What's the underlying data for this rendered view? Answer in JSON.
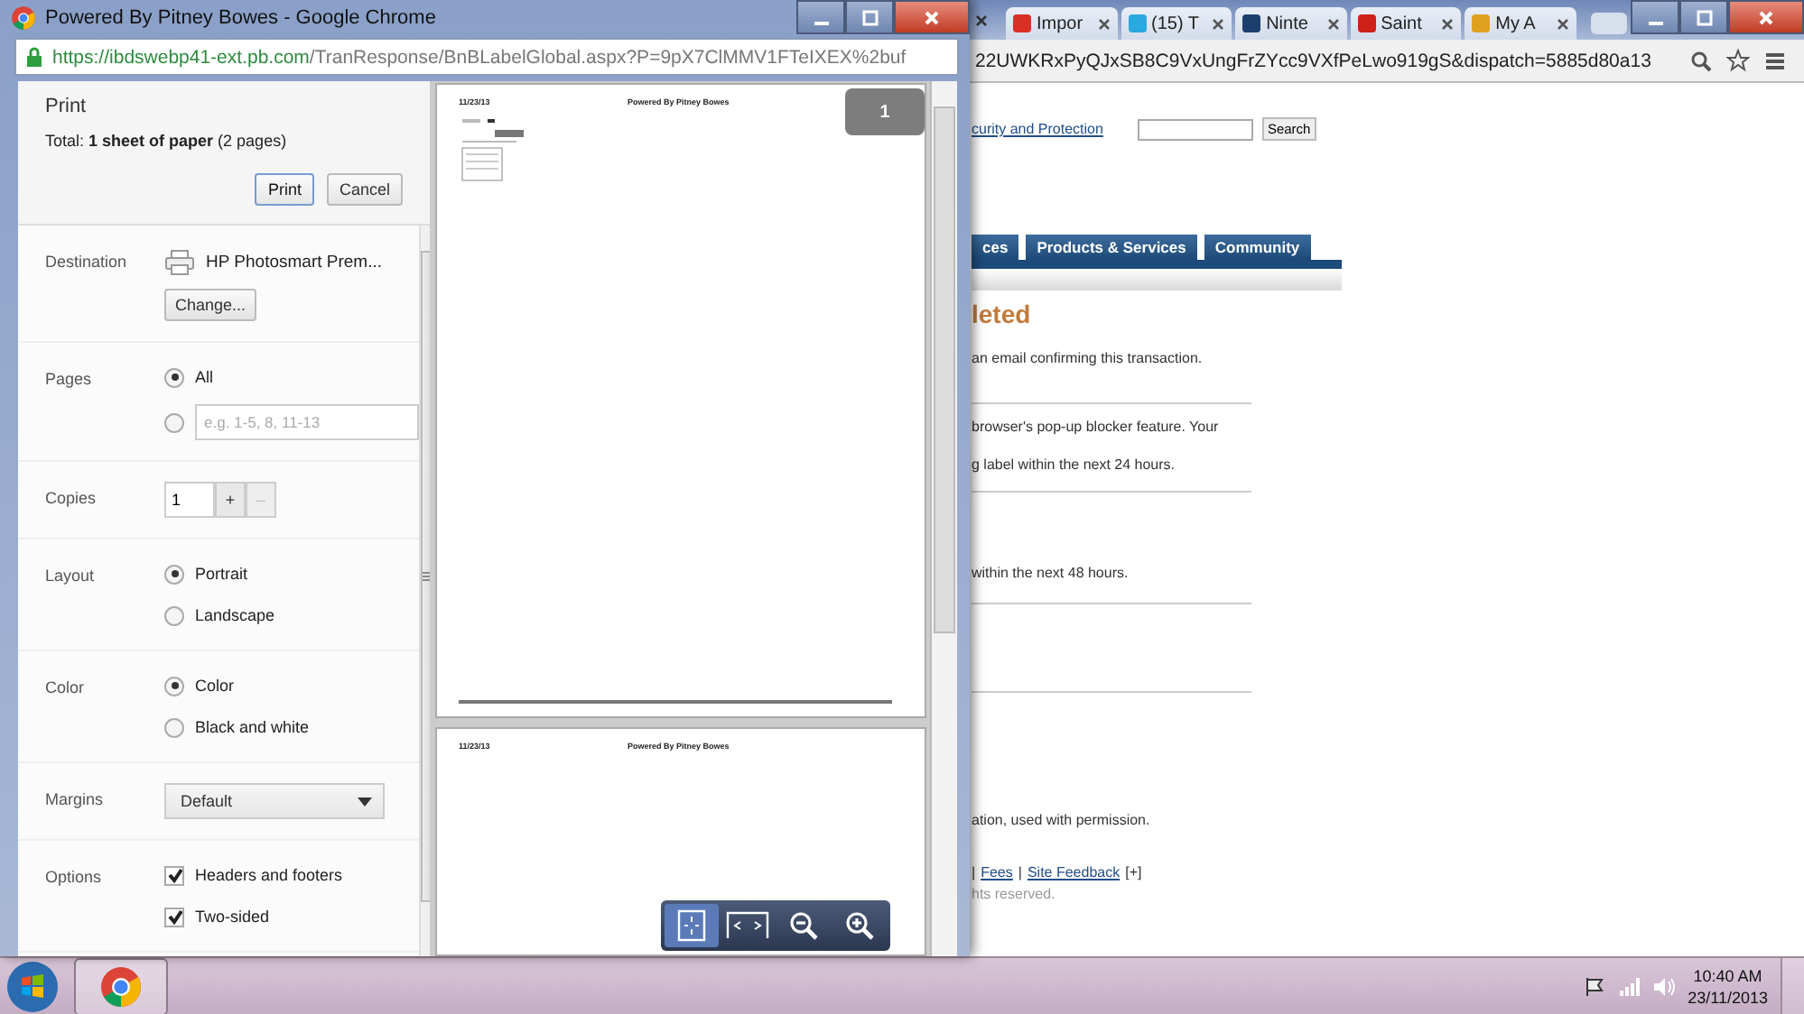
{
  "background_window": {
    "tabs": [
      {
        "label": "Impor",
        "color": "#d93025"
      },
      {
        "label": "(15) T",
        "color": "#2aa9e0"
      },
      {
        "label": "Ninte",
        "color": "#1c3f6e"
      },
      {
        "label": "Saint",
        "color": "#d0201a"
      },
      {
        "label": "My A",
        "color": "#e0a020"
      }
    ],
    "url_tail": "22UWKRxPyQJxSB8C9VxUngFrZYcc9VXfPeLwo919gS&dispatch=5885d80a13",
    "page": {
      "top_link": "curity and Protection",
      "search_button": "Search",
      "nav_tabs": [
        "ces",
        "Products & Services",
        "Community"
      ],
      "heading": "leted",
      "blocks": [
        {
          "kind": "text",
          "text": "an email confirming this transaction."
        },
        {
          "kind": "rule"
        },
        {
          "kind": "text",
          "text": "browser's pop-up blocker feature. Your"
        },
        {
          "kind": "text",
          "text": "g label within the next 24 hours."
        },
        {
          "kind": "rule"
        },
        {
          "kind": "text",
          "text": "within the next 48 hours."
        },
        {
          "kind": "rule"
        },
        {
          "kind": "rule"
        },
        {
          "kind": "text",
          "text": "ation, used with permission."
        }
      ],
      "footer_links": [
        "Fees",
        "Site Feedback"
      ],
      "link_separator": "|",
      "expand": "[+]",
      "copyright": "hts reserved."
    }
  },
  "popup_window": {
    "title": "Powered By Pitney Bowes - Google Chrome",
    "url_host": "https://ibdswebp41-ext.pb.com",
    "url_path": "/TranResponse/BnBLabelGlobal.aspx?P=9pX7ClMMV1FTeIXEX%2buf"
  },
  "print_panel": {
    "title": "Print",
    "total": "Total: **1 sheet of paper** (2 pages)",
    "buttons": [
      {
        "label": "Print",
        "primary": true
      },
      {
        "label": "Cancel",
        "primary": false
      }
    ],
    "settings": [
      {
        "kind": "destination",
        "label": "Destination",
        "printer": "HP Photosmart Prem...",
        "button": "Change..."
      },
      {
        "kind": "radio",
        "label": "Pages",
        "options": [
          {
            "label": "All",
            "selected": true
          },
          {
            "placeholder": "e.g. 1-5, 8, 11-13",
            "selected": false
          }
        ]
      },
      {
        "kind": "copies",
        "label": "Copies",
        "value": "1",
        "plus": "+",
        "minus": "–"
      },
      {
        "kind": "radio",
        "label": "Layout",
        "options": [
          {
            "label": "Portrait",
            "selected": true
          },
          {
            "label": "Landscape",
            "selected": false
          }
        ]
      },
      {
        "kind": "radio",
        "label": "Color",
        "options": [
          {
            "label": "Color",
            "selected": true
          },
          {
            "label": "Black and white",
            "selected": false
          }
        ]
      },
      {
        "kind": "select",
        "label": "Margins",
        "value": "Default"
      },
      {
        "kind": "checkboxes",
        "label": "Options",
        "items": [
          {
            "label": "Headers and footers",
            "checked": true
          },
          {
            "label": "Two-sided",
            "checked": true
          }
        ]
      }
    ]
  },
  "preview": {
    "page_badge": "1",
    "pages": [
      {
        "date": "11/23/13",
        "title": "Powered By Pitney Bowes",
        "label_image": true
      },
      {
        "date": "11/23/13",
        "title": "Powered By Pitney Bowes",
        "label_image": false
      }
    ],
    "zoom_tools": [
      {
        "kind": "fit",
        "selected": true
      },
      {
        "kind": "width",
        "selected": false
      },
      {
        "kind": "zoom-out",
        "selected": false
      },
      {
        "kind": "zoom-in",
        "selected": false
      }
    ]
  },
  "taskbar": {
    "time": "10:40 AM",
    "date": "23/11/2013"
  }
}
